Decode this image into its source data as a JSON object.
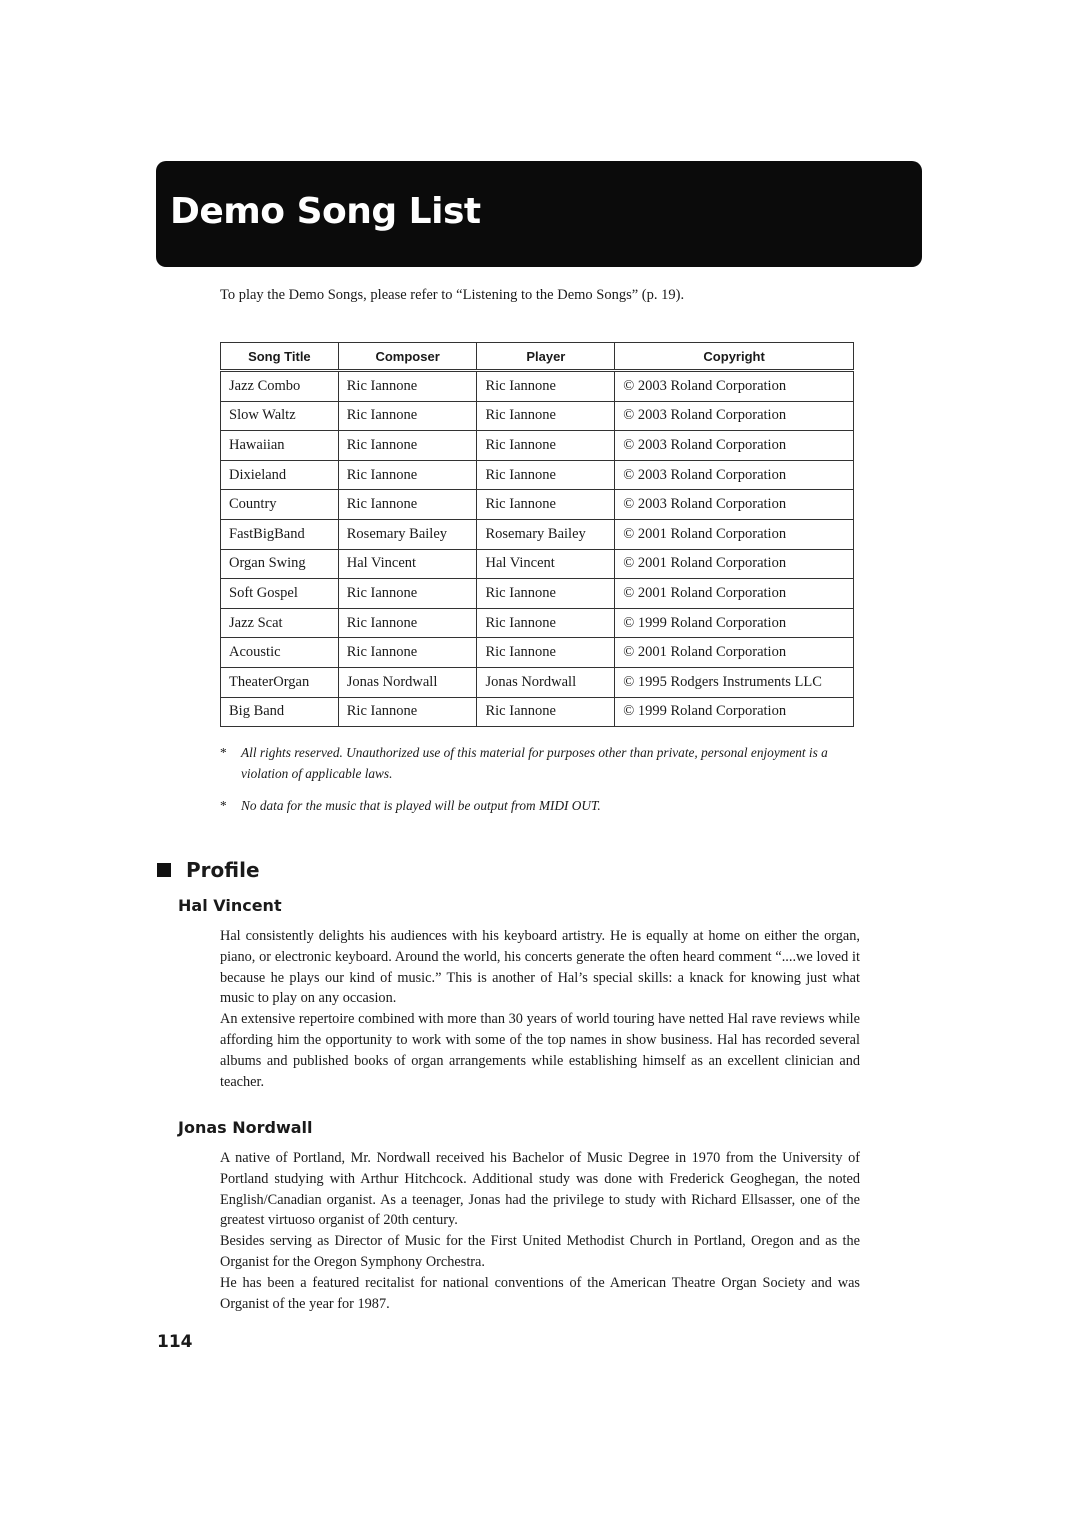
{
  "header": {
    "title": "Demo Song List"
  },
  "intro": "To play the Demo Songs, please refer to “Listening to the Demo Songs” (p. 19).",
  "table": {
    "columns": [
      "Song Title",
      "Composer",
      "Player",
      "Copyright"
    ],
    "rows": [
      [
        "Jazz Combo",
        "Ric Iannone",
        "Ric Iannone",
        "© 2003 Roland Corporation"
      ],
      [
        "Slow Waltz",
        "Ric Iannone",
        "Ric Iannone",
        "© 2003 Roland Corporation"
      ],
      [
        "Hawaiian",
        "Ric Iannone",
        "Ric Iannone",
        "© 2003 Roland Corporation"
      ],
      [
        "Dixieland",
        "Ric Iannone",
        "Ric Iannone",
        "© 2003 Roland Corporation"
      ],
      [
        "Country",
        "Ric Iannone",
        "Ric Iannone",
        "© 2003 Roland Corporation"
      ],
      [
        "FastBigBand",
        "Rosemary Bailey",
        "Rosemary Bailey",
        "© 2001 Roland Corporation"
      ],
      [
        "Organ Swing",
        "Hal Vincent",
        "Hal Vincent",
        "© 2001 Roland Corporation"
      ],
      [
        "Soft Gospel",
        "Ric Iannone",
        "Ric Iannone",
        "© 2001 Roland Corporation"
      ],
      [
        "Jazz Scat",
        "Ric Iannone",
        "Ric Iannone",
        "© 1999 Roland Corporation"
      ],
      [
        "Acoustic",
        "Ric Iannone",
        "Ric Iannone",
        "© 2001 Roland Corporation"
      ],
      [
        "TheaterOrgan",
        "Jonas Nordwall",
        "Jonas Nordwall",
        "© 1995 Rodgers Instruments LLC"
      ],
      [
        "Big Band",
        "Ric Iannone",
        "Ric Iannone",
        "© 1999 Roland Corporation"
      ]
    ]
  },
  "notes": [
    {
      "marker": "*",
      "text": "All rights reserved. Unauthorized use of this material for purposes other than private, personal enjoyment is a violation of applicable laws."
    },
    {
      "marker": "*",
      "text": "No data for the music that is played will be output from MIDI OUT."
    }
  ],
  "profile": {
    "heading": "Profile",
    "people": [
      {
        "name": "Hal Vincent",
        "paragraphs": [
          "Hal consistently delights his audiences with his keyboard artistry. He is equally at home on either the organ, piano, or electronic keyboard. Around the world, his concerts generate the often heard comment “....we loved it because he plays our kind of music.” This is another of Hal’s special skills: a knack for knowing just what music to play on any occasion.",
          "An extensive repertoire combined with more than 30 years of world touring have netted Hal rave reviews while affording him the opportunity to work with some of the top names in show business. Hal has recorded several albums and published books of organ arrangements while establishing himself as an excellent clinician and teacher."
        ]
      },
      {
        "name": "Jonas Nordwall",
        "paragraphs": [
          "A native of Portland, Mr. Nordwall received his Bachelor of Music Degree in 1970 from the University of Portland studying with Arthur Hitchcock. Additional study was done with Frederick Geoghegan, the noted English/Canadian organist. As a teenager, Jonas had the privilege to study with Richard Ellsasser, one of the greatest virtuoso organist of 20th century.",
          "Besides serving as Director of Music for the First United Methodist Church in Portland, Oregon and as the Organist for the Oregon Symphony Orchestra.",
          "He has been a featured recitalist for national conventions of the American Theatre Organ Society and was Organist of the year for 1987."
        ]
      }
    ]
  },
  "page_number": "114"
}
